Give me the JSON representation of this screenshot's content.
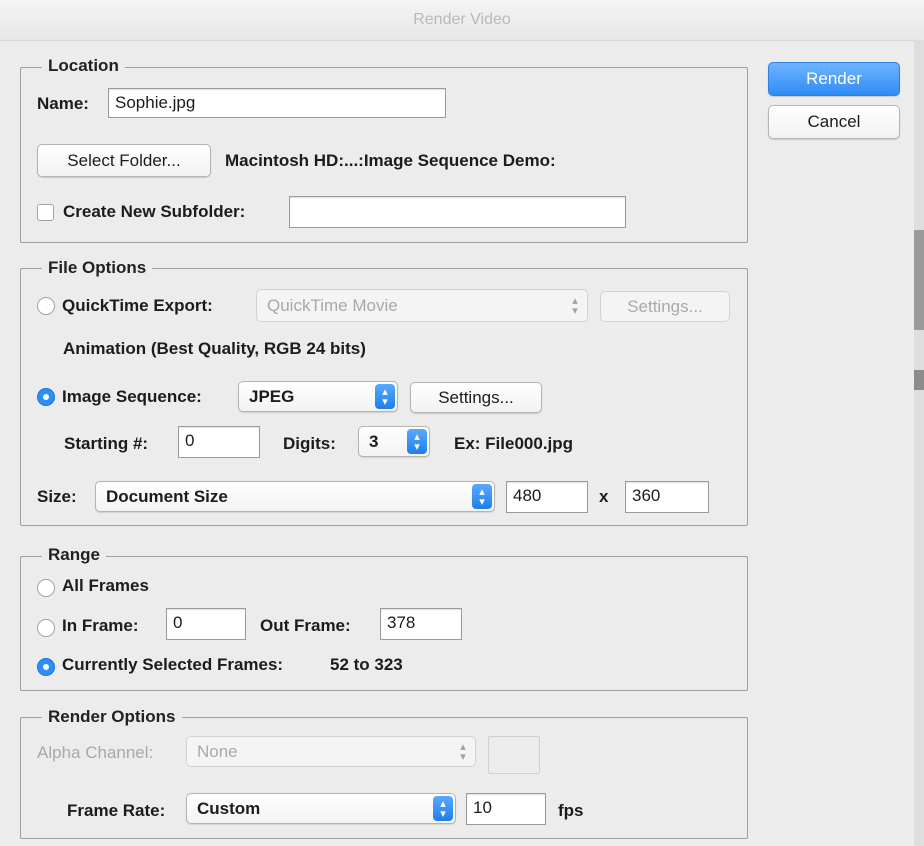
{
  "window": {
    "title": "Render Video"
  },
  "actions": {
    "render": "Render",
    "cancel": "Cancel"
  },
  "location": {
    "legend": "Location",
    "name_label": "Name:",
    "name_value": "Sophie.jpg",
    "select_folder": "Select Folder...",
    "folder_path": "Macintosh HD:...:Image Sequence Demo:",
    "subfolder_label": "Create New Subfolder:",
    "subfolder_value": "",
    "subfolder_checked": false
  },
  "file_options": {
    "legend": "File Options",
    "quicktime_label": "QuickTime Export:",
    "quicktime_format": "QuickTime Movie",
    "quicktime_settings": "Settings...",
    "quicktime_desc": "Animation (Best Quality, RGB 24 bits)",
    "image_seq_label": "Image Sequence:",
    "image_seq_format": "JPEG",
    "image_seq_settings": "Settings...",
    "starting_label": "Starting #:",
    "starting_value": "0",
    "digits_label": "Digits:",
    "digits_value": "3",
    "example": "Ex: File000.jpg",
    "size_label": "Size:",
    "size_value": "Document Size",
    "width": "480",
    "x_label": "x",
    "height": "360",
    "selected": "image_sequence"
  },
  "range": {
    "legend": "Range",
    "all_frames": "All Frames",
    "in_frame_label": "In Frame:",
    "in_frame_value": "0",
    "out_frame_label": "Out Frame:",
    "out_frame_value": "378",
    "current_label": "Currently Selected Frames:",
    "current_value": "52 to 323",
    "selected": "currently_selected"
  },
  "render_options": {
    "legend": "Render Options",
    "alpha_label": "Alpha Channel:",
    "alpha_value": "None",
    "frame_rate_label": "Frame Rate:",
    "frame_rate_value": "Custom",
    "fps_value": "10",
    "fps_unit": "fps"
  },
  "colors": {
    "accent": "#2c8ef8",
    "title_text": "#b9b9b9"
  }
}
